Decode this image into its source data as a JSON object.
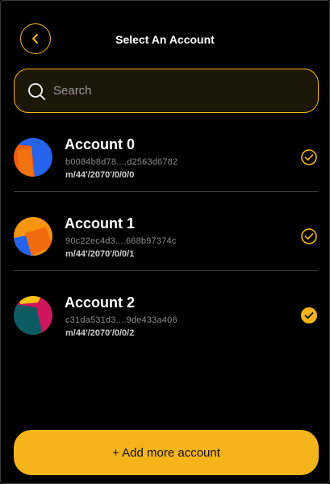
{
  "header": {
    "title": "Select An Account",
    "back_icon": "chevron-left-icon"
  },
  "search": {
    "placeholder": "Search",
    "value": ""
  },
  "accounts": [
    {
      "name": "Account 0",
      "address": "b0084b8d78....d2563d6782",
      "path": "m/44'/2070'/0/0/0",
      "selected": false
    },
    {
      "name": "Account 1",
      "address": "90c22ec4d3....668b97374c",
      "path": "m/44'/2070'/0/0/1",
      "selected": false
    },
    {
      "name": "Account 2",
      "address": "c31da531d3....9de433a406",
      "path": "m/44'/2070'/0/0/2",
      "selected": true
    }
  ],
  "footer": {
    "add_label": "+ Add more account"
  },
  "colors": {
    "accent": "#f5b41a",
    "background": "#000000",
    "search_bg": "#1d170a"
  }
}
